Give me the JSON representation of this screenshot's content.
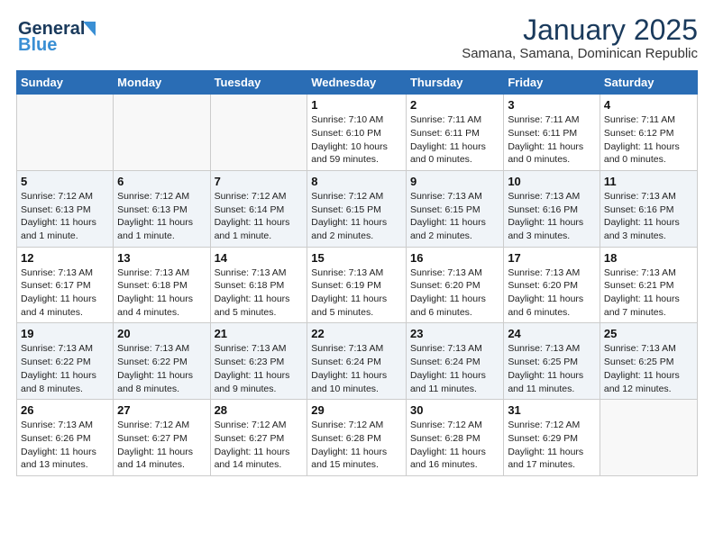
{
  "header": {
    "logo_line1": "General",
    "logo_line2": "Blue",
    "month_title": "January 2025",
    "location": "Samana, Samana, Dominican Republic"
  },
  "days_of_week": [
    "Sunday",
    "Monday",
    "Tuesday",
    "Wednesday",
    "Thursday",
    "Friday",
    "Saturday"
  ],
  "weeks": [
    [
      {
        "day": "",
        "info": ""
      },
      {
        "day": "",
        "info": ""
      },
      {
        "day": "",
        "info": ""
      },
      {
        "day": "1",
        "info": "Sunrise: 7:10 AM\nSunset: 6:10 PM\nDaylight: 10 hours and 59 minutes."
      },
      {
        "day": "2",
        "info": "Sunrise: 7:11 AM\nSunset: 6:11 PM\nDaylight: 11 hours and 0 minutes."
      },
      {
        "day": "3",
        "info": "Sunrise: 7:11 AM\nSunset: 6:11 PM\nDaylight: 11 hours and 0 minutes."
      },
      {
        "day": "4",
        "info": "Sunrise: 7:11 AM\nSunset: 6:12 PM\nDaylight: 11 hours and 0 minutes."
      }
    ],
    [
      {
        "day": "5",
        "info": "Sunrise: 7:12 AM\nSunset: 6:13 PM\nDaylight: 11 hours and 1 minute."
      },
      {
        "day": "6",
        "info": "Sunrise: 7:12 AM\nSunset: 6:13 PM\nDaylight: 11 hours and 1 minute."
      },
      {
        "day": "7",
        "info": "Sunrise: 7:12 AM\nSunset: 6:14 PM\nDaylight: 11 hours and 1 minute."
      },
      {
        "day": "8",
        "info": "Sunrise: 7:12 AM\nSunset: 6:15 PM\nDaylight: 11 hours and 2 minutes."
      },
      {
        "day": "9",
        "info": "Sunrise: 7:13 AM\nSunset: 6:15 PM\nDaylight: 11 hours and 2 minutes."
      },
      {
        "day": "10",
        "info": "Sunrise: 7:13 AM\nSunset: 6:16 PM\nDaylight: 11 hours and 3 minutes."
      },
      {
        "day": "11",
        "info": "Sunrise: 7:13 AM\nSunset: 6:16 PM\nDaylight: 11 hours and 3 minutes."
      }
    ],
    [
      {
        "day": "12",
        "info": "Sunrise: 7:13 AM\nSunset: 6:17 PM\nDaylight: 11 hours and 4 minutes."
      },
      {
        "day": "13",
        "info": "Sunrise: 7:13 AM\nSunset: 6:18 PM\nDaylight: 11 hours and 4 minutes."
      },
      {
        "day": "14",
        "info": "Sunrise: 7:13 AM\nSunset: 6:18 PM\nDaylight: 11 hours and 5 minutes."
      },
      {
        "day": "15",
        "info": "Sunrise: 7:13 AM\nSunset: 6:19 PM\nDaylight: 11 hours and 5 minutes."
      },
      {
        "day": "16",
        "info": "Sunrise: 7:13 AM\nSunset: 6:20 PM\nDaylight: 11 hours and 6 minutes."
      },
      {
        "day": "17",
        "info": "Sunrise: 7:13 AM\nSunset: 6:20 PM\nDaylight: 11 hours and 6 minutes."
      },
      {
        "day": "18",
        "info": "Sunrise: 7:13 AM\nSunset: 6:21 PM\nDaylight: 11 hours and 7 minutes."
      }
    ],
    [
      {
        "day": "19",
        "info": "Sunrise: 7:13 AM\nSunset: 6:22 PM\nDaylight: 11 hours and 8 minutes."
      },
      {
        "day": "20",
        "info": "Sunrise: 7:13 AM\nSunset: 6:22 PM\nDaylight: 11 hours and 8 minutes."
      },
      {
        "day": "21",
        "info": "Sunrise: 7:13 AM\nSunset: 6:23 PM\nDaylight: 11 hours and 9 minutes."
      },
      {
        "day": "22",
        "info": "Sunrise: 7:13 AM\nSunset: 6:24 PM\nDaylight: 11 hours and 10 minutes."
      },
      {
        "day": "23",
        "info": "Sunrise: 7:13 AM\nSunset: 6:24 PM\nDaylight: 11 hours and 11 minutes."
      },
      {
        "day": "24",
        "info": "Sunrise: 7:13 AM\nSunset: 6:25 PM\nDaylight: 11 hours and 11 minutes."
      },
      {
        "day": "25",
        "info": "Sunrise: 7:13 AM\nSunset: 6:25 PM\nDaylight: 11 hours and 12 minutes."
      }
    ],
    [
      {
        "day": "26",
        "info": "Sunrise: 7:13 AM\nSunset: 6:26 PM\nDaylight: 11 hours and 13 minutes."
      },
      {
        "day": "27",
        "info": "Sunrise: 7:12 AM\nSunset: 6:27 PM\nDaylight: 11 hours and 14 minutes."
      },
      {
        "day": "28",
        "info": "Sunrise: 7:12 AM\nSunset: 6:27 PM\nDaylight: 11 hours and 14 minutes."
      },
      {
        "day": "29",
        "info": "Sunrise: 7:12 AM\nSunset: 6:28 PM\nDaylight: 11 hours and 15 minutes."
      },
      {
        "day": "30",
        "info": "Sunrise: 7:12 AM\nSunset: 6:28 PM\nDaylight: 11 hours and 16 minutes."
      },
      {
        "day": "31",
        "info": "Sunrise: 7:12 AM\nSunset: 6:29 PM\nDaylight: 11 hours and 17 minutes."
      },
      {
        "day": "",
        "info": ""
      }
    ]
  ]
}
